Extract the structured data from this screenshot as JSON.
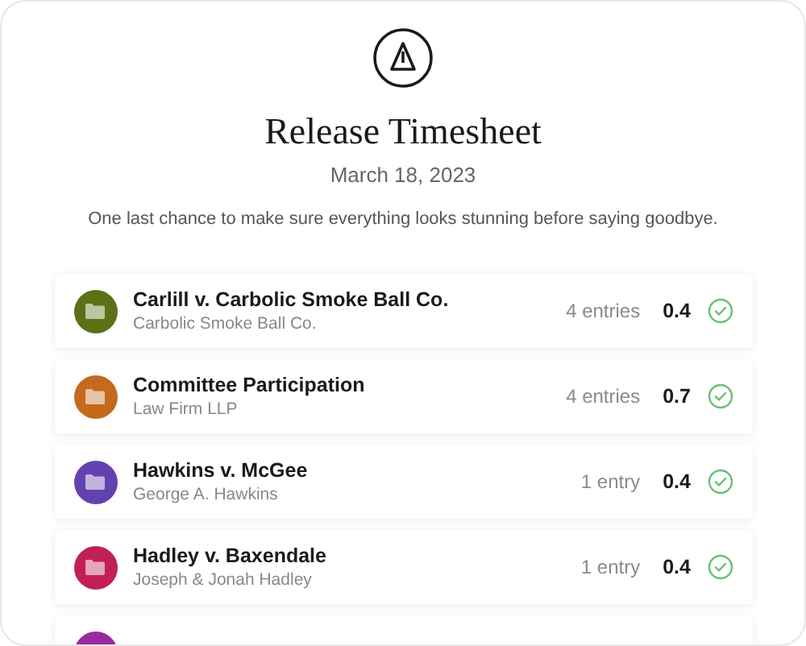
{
  "dialog": {
    "title": "Release Timesheet",
    "date": "March 18, 2023",
    "message": "One last chance to make sure everything looks stunning before saying goodbye."
  },
  "matters": [
    {
      "title": "Carlill v. Carbolic Smoke Ball Co.",
      "client": "Carbolic Smoke Ball Co.",
      "entries": "4 entries",
      "hours": "0.4",
      "checked": true,
      "color": "#5e7016"
    },
    {
      "title": "Committee Participation",
      "client": "Law Firm LLP",
      "entries": "4 entries",
      "hours": "0.7",
      "checked": true,
      "color": "#c46a1c"
    },
    {
      "title": "Hawkins v. McGee",
      "client": "George A. Hawkins",
      "entries": "1 entry",
      "hours": "0.4",
      "checked": true,
      "color": "#6441b0"
    },
    {
      "title": "Hadley v. Baxendale",
      "client": "Joseph & Jonah Hadley",
      "entries": "1 entry",
      "hours": "0.4",
      "checked": true,
      "color": "#c21f57"
    },
    {
      "color": "#9a2aa0"
    }
  ]
}
